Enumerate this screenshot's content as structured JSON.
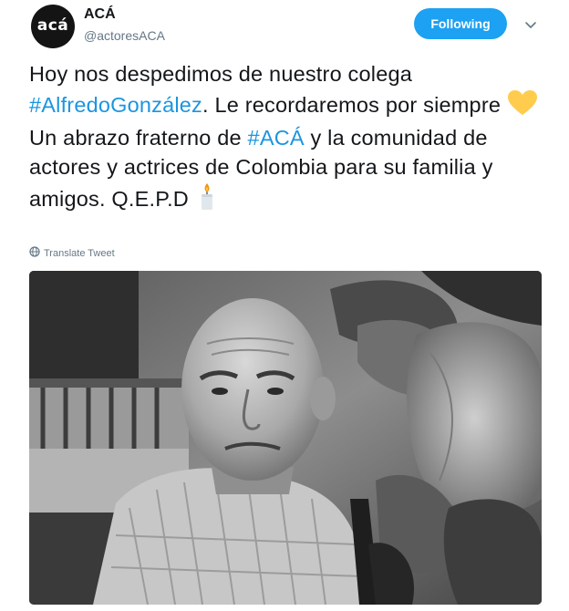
{
  "account": {
    "display_name": "ACÁ",
    "handle": "@actoresACA",
    "avatar_text": "acá"
  },
  "follow_button": {
    "label": "Following"
  },
  "tweet": {
    "t1": "Hoy nos despedimos de nuestro colega ",
    "hashtag1": "#AlfredoGonzález",
    "t2": ". Le recordaremos por siempre ",
    "t3": "Un abrazo fraterno de ",
    "hashtag2": "#ACÁ",
    "t4": " y la comunidad de actores y actrices de Colombia para su familia y amigos. Q.E.P.D "
  },
  "translate": {
    "label": "Translate Tweet"
  },
  "icons": {
    "heart": "yellow-heart-icon",
    "candle": "candle-icon",
    "globe": "globe-icon",
    "caret": "chevron-down-icon"
  },
  "colors": {
    "accent": "#1da1f2",
    "hashtag": "#1b95e0",
    "secondary_text": "#657786",
    "heart": "#ffcc4d"
  }
}
